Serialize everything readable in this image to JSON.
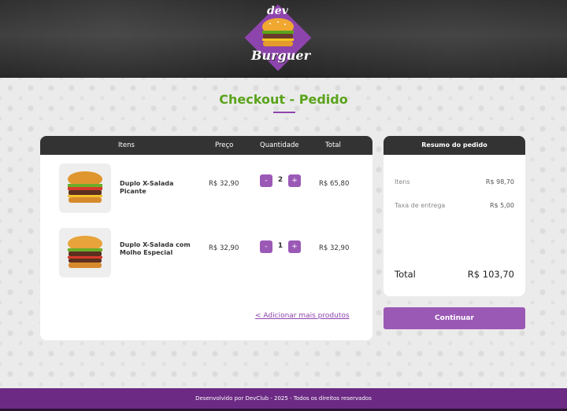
{
  "brand": {
    "logo_top": "dev",
    "logo_bottom": "Burguer"
  },
  "page": {
    "title": "Checkout - Pedido"
  },
  "cart": {
    "headers": {
      "items": "Itens",
      "price": "Preço",
      "quantity": "Quantidade",
      "total": "Total"
    },
    "rows": [
      {
        "name": "Duplo X-Salada Picante",
        "price": "R$ 32,90",
        "quantity": "2",
        "total": "R$ 65,80"
      },
      {
        "name": "Duplo X-Salada com Molho Especial",
        "price": "R$ 32,90",
        "quantity": "1",
        "total": "R$ 32,90"
      }
    ],
    "minus": "-",
    "plus": "+",
    "add_more": "< Adicionar mais produtos"
  },
  "summary": {
    "title": "Resumo do pedido",
    "items_label": "Itens",
    "items_value": "R$ 98,70",
    "fee_label": "Taxa de entrega",
    "fee_value": "R$  5,00",
    "total_label": "Total",
    "total_value": "R$ 103,70",
    "continue": "Continuar"
  },
  "footer": {
    "text": "Desenvolvido por DevClub - 2025 - Todos os direitos reservados"
  },
  "colors": {
    "accent": "#9b59b6",
    "title_green": "#5aa31b",
    "footer": "#6c2a84",
    "dark": "#333333"
  }
}
